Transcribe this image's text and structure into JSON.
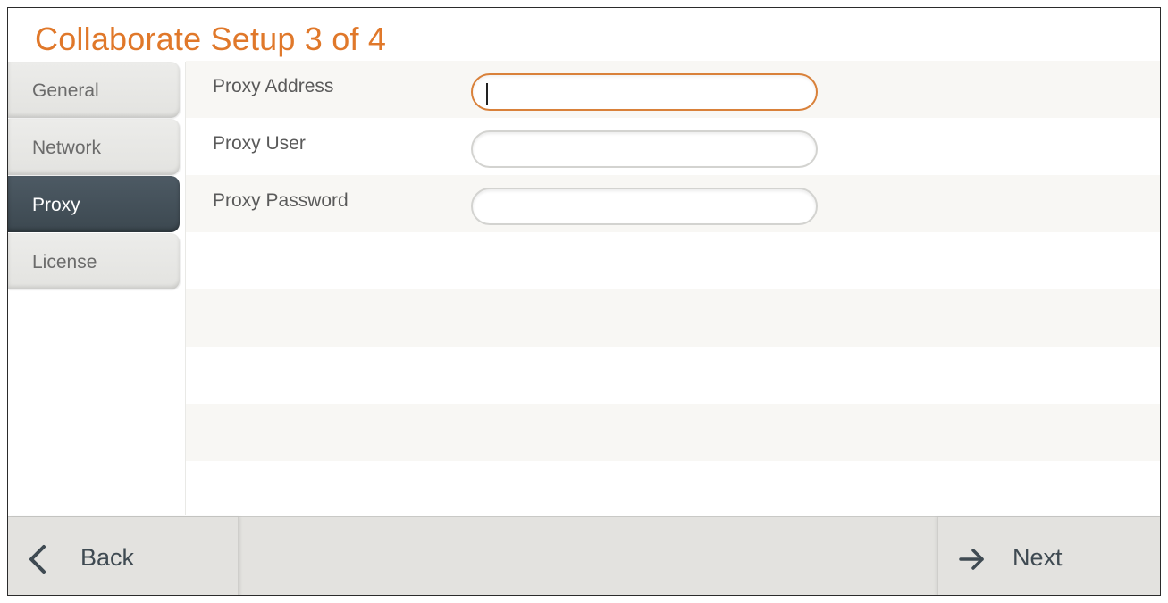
{
  "title": "Collaborate Setup 3 of 4",
  "sidebar": {
    "items": [
      {
        "label": "General",
        "active": false
      },
      {
        "label": "Network",
        "active": false
      },
      {
        "label": "Proxy",
        "active": true
      },
      {
        "label": "License",
        "active": false
      }
    ]
  },
  "form": {
    "fields": [
      {
        "label": "Proxy Address",
        "value": "",
        "focused": true
      },
      {
        "label": "Proxy User",
        "value": "",
        "focused": false
      },
      {
        "label": "Proxy Password",
        "value": "",
        "focused": false
      }
    ]
  },
  "footer": {
    "back_label": "Back",
    "next_label": "Next",
    "back_icon": "chevron-left-icon",
    "next_icon": "arrow-right-icon"
  },
  "colors": {
    "title": "#e0782a",
    "active_tab": "#46525b",
    "focus_border": "#d9813a"
  }
}
